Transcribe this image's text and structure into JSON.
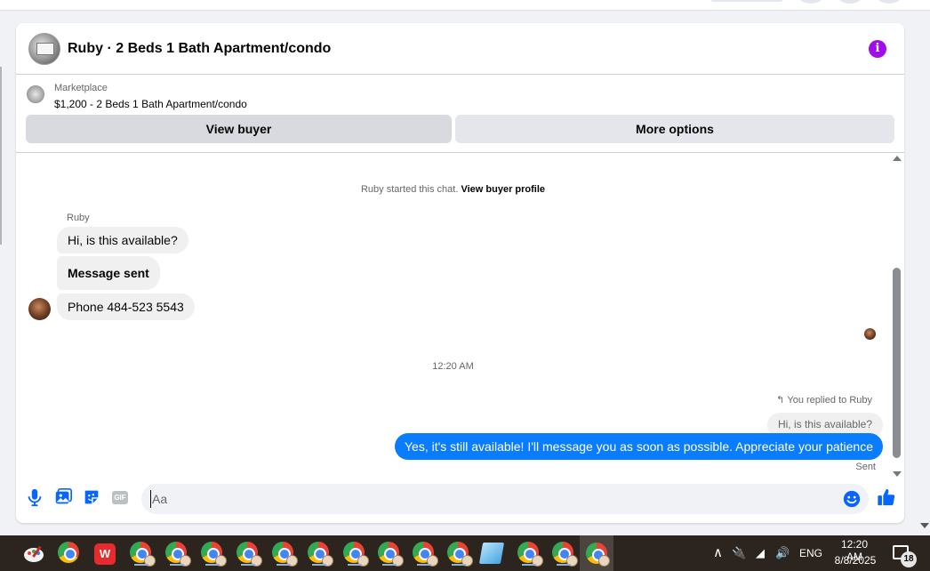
{
  "chat": {
    "title": "Ruby · 2 Beds 1 Bath Apartment/condo",
    "info_icon": "info-icon",
    "listing": {
      "source": "Marketplace",
      "price_title": "$1,200 - 2 Beds 1 Bath Apartment/condo"
    },
    "buttons": {
      "view_buyer": "View buyer",
      "more_options": "More options"
    }
  },
  "messages": {
    "started_text": "Ruby started this chat.",
    "started_link": "View buyer profile",
    "sender_name": "Ruby",
    "incoming": [
      "Hi, is this available?",
      "Message sent",
      "Phone 484-523 5543"
    ],
    "time_separator": "12:20 AM",
    "replied_label": "You replied to Ruby",
    "quoted_text": "Hi, is this available?",
    "outgoing": "Yes, it's still available! I'll message you as soon as possible. Appreciate your patience",
    "status": "Sent"
  },
  "composer": {
    "placeholder": "Aa",
    "value": "",
    "gif_label": "GIF",
    "icons": [
      "microphone-icon",
      "photo-icon",
      "sticker-icon",
      "gif-icon",
      "emoji-icon",
      "like-icon"
    ]
  },
  "colors": {
    "accent": "#0866ff",
    "outgoing_bubble": "#0a7cff",
    "info_icon": "#a20ce8",
    "taskbar": "#2c241e"
  },
  "taskbar": {
    "language": "ENG",
    "time": "12:20 AM",
    "date": "8/8/2025",
    "notification_count": "18"
  }
}
